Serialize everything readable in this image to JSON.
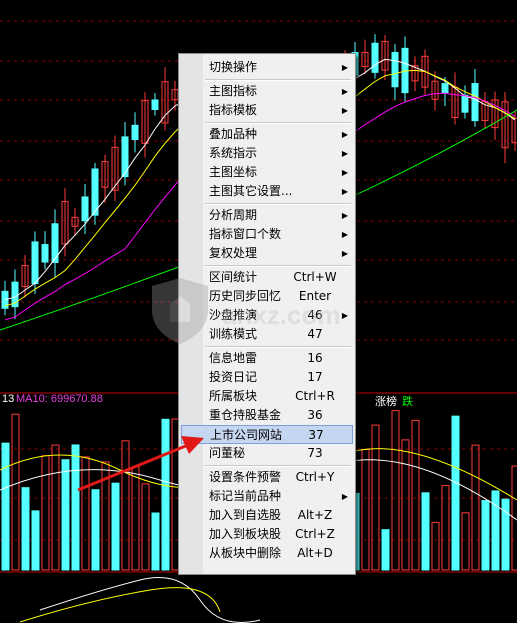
{
  "indicator": {
    "left_text": "13",
    "ma_text": "MA10: 699670.88",
    "right_label_a": "涨榜",
    "right_label_b": "跌"
  },
  "watermark": {
    "text": "anxz.com"
  },
  "menu": {
    "items": [
      {
        "label": "切换操作",
        "shortcut": "",
        "submenu": true
      },
      {
        "sep": true
      },
      {
        "label": "主图指标",
        "shortcut": "",
        "submenu": true
      },
      {
        "label": "指标模板",
        "shortcut": "",
        "submenu": true
      },
      {
        "sep": true
      },
      {
        "label": "叠加品种",
        "shortcut": "",
        "submenu": true
      },
      {
        "label": "系统指示",
        "shortcut": "",
        "submenu": true
      },
      {
        "label": "主图坐标",
        "shortcut": "",
        "submenu": true
      },
      {
        "label": "主图其它设置...",
        "shortcut": "",
        "submenu": true
      },
      {
        "sep": true
      },
      {
        "label": "分析周期",
        "shortcut": "",
        "submenu": true
      },
      {
        "label": "指标窗口个数",
        "shortcut": "",
        "submenu": true
      },
      {
        "label": "复权处理",
        "shortcut": "",
        "submenu": true
      },
      {
        "sep": true
      },
      {
        "label": "区间统计",
        "shortcut": "Ctrl+W",
        "submenu": false
      },
      {
        "label": "历史同步回忆",
        "shortcut": "Enter",
        "submenu": false
      },
      {
        "label": "沙盘推演",
        "shortcut": "46",
        "submenu": true
      },
      {
        "label": "训练模式",
        "shortcut": "47",
        "submenu": false
      },
      {
        "sep": true
      },
      {
        "label": "信息地雷",
        "shortcut": "16",
        "submenu": false
      },
      {
        "label": "投资日记",
        "shortcut": "17",
        "submenu": false
      },
      {
        "label": "所属板块",
        "shortcut": "Ctrl+R",
        "submenu": false
      },
      {
        "label": "重仓持股基金",
        "shortcut": "36",
        "submenu": false
      },
      {
        "label": "上市公司网站",
        "shortcut": "37",
        "submenu": false,
        "highlighted": true
      },
      {
        "label": "问董秘",
        "shortcut": "73",
        "submenu": false
      },
      {
        "sep": true
      },
      {
        "label": "设置条件预警",
        "shortcut": "Ctrl+Y",
        "submenu": false
      },
      {
        "label": "标记当前品种",
        "shortcut": "",
        "submenu": true
      },
      {
        "label": "加入到自选股",
        "shortcut": "Alt+Z",
        "submenu": false
      },
      {
        "label": "加入到板块股",
        "shortcut": "Ctrl+Z",
        "submenu": false
      },
      {
        "label": "从板块中删除",
        "shortcut": "Alt+D",
        "submenu": false
      }
    ]
  },
  "colors": {
    "up": "#ff3c3c",
    "down": "#54ffff",
    "ma5": "#ffffff",
    "ma10": "#ffff00",
    "ma20": "#ff00ff",
    "ma60": "#00ff00",
    "highlight": "#c5d6f0",
    "arrow": "#e01818"
  }
}
